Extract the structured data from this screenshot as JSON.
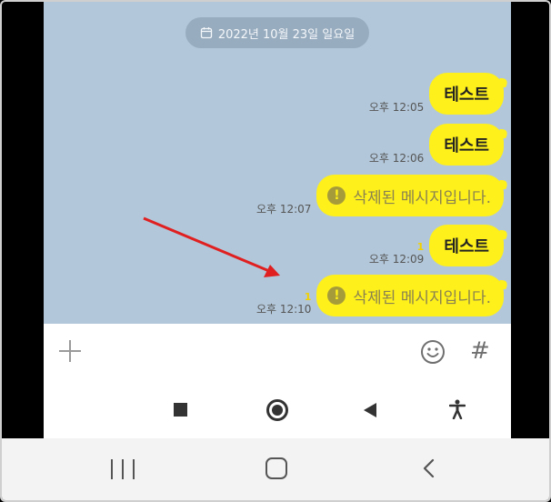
{
  "chat": {
    "date_label": "2022년 10월 23일 일요일",
    "messages": [
      {
        "text": "테스트",
        "time": "오후 12:05",
        "unread": "",
        "deleted": false
      },
      {
        "text": "테스트",
        "time": "오후 12:06",
        "unread": "",
        "deleted": false
      },
      {
        "text": "삭제된 메시지입니다.",
        "time": "오후 12:07",
        "unread": "",
        "deleted": true
      },
      {
        "text": "테스트",
        "time": "오후 12:09",
        "unread": "1",
        "deleted": false
      },
      {
        "text": "삭제된 메시지입니다.",
        "time": "오후 12:10",
        "unread": "1",
        "deleted": true
      }
    ],
    "deleted_icon": "exclamation-icon"
  },
  "input_bar": {
    "icons": [
      "plus-icon",
      "emoji-icon",
      "hash-icon"
    ],
    "hash_glyph": "#"
  },
  "navigation": {
    "inner": [
      "stop-square-icon",
      "record-circle-icon",
      "back-triangle-icon",
      "accessibility-icon"
    ],
    "outer": [
      "recents-icon",
      "home-icon",
      "back-chevron-icon"
    ]
  },
  "colors": {
    "chat_background": "#b2c7d9",
    "bubble": "#fef01b",
    "unread_count": "#f2d100",
    "annotation_arrow": "#e02020"
  }
}
